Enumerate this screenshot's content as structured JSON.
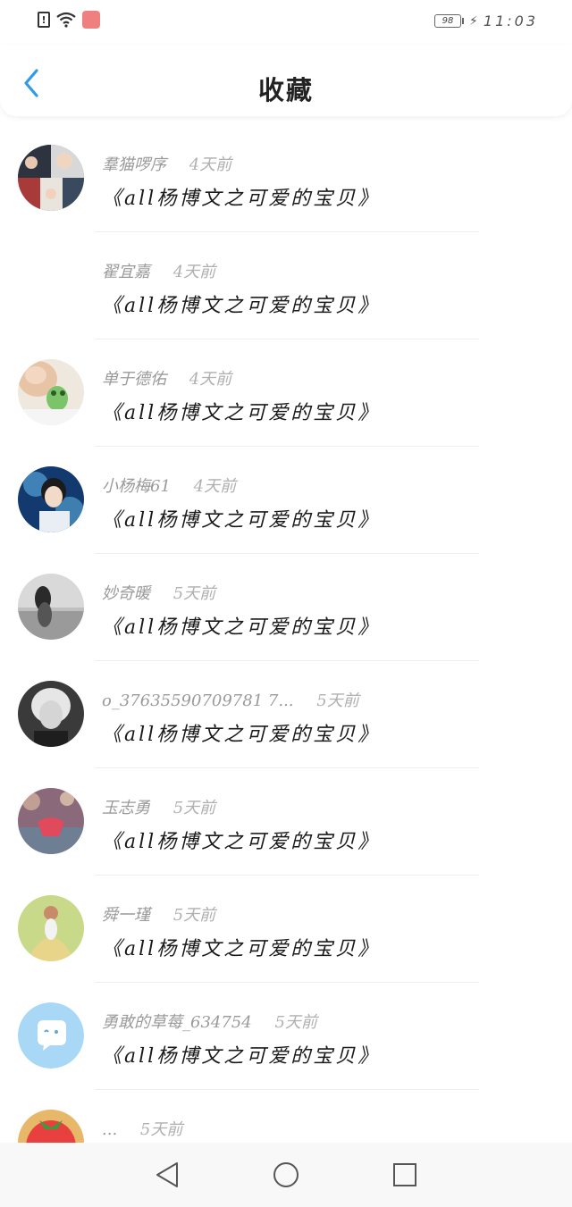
{
  "status_bar": {
    "battery_level": "98",
    "time": "11:03",
    "colors": {
      "app_badge": "#f08080"
    }
  },
  "header": {
    "title": "收藏",
    "back_icon": "chevron-left-icon",
    "accent": "#2f9bea"
  },
  "favorites": [
    {
      "user": "羣猫啰序",
      "time": "4天前",
      "title": "《all杨博文之可爱的宝贝》",
      "avatar": "photo-collage"
    },
    {
      "user": "翟宜嘉",
      "time": "4天前",
      "title": "《all杨博文之可爱的宝贝》",
      "avatar": "none"
    },
    {
      "user": "单于德佑",
      "time": "4天前",
      "title": "《all杨博文之可爱的宝贝》",
      "avatar": "photo-green-toy"
    },
    {
      "user": "小杨梅61",
      "time": "4天前",
      "title": "《all杨博文之可爱的宝贝》",
      "avatar": "photo-blue-portrait"
    },
    {
      "user": "妙奇暖",
      "time": "5天前",
      "title": "《all杨博文之可爱的宝贝》",
      "avatar": "photo-grey-seaside"
    },
    {
      "user": "o_37635590709781 7...",
      "time": "5天前",
      "title": "《all杨博文之可爱的宝贝》",
      "avatar": "photo-black-white-portrait"
    },
    {
      "user": "玉志勇",
      "time": "5天前",
      "title": "《all杨博文之可爱的宝贝》",
      "avatar": "photo-pink-bokeh"
    },
    {
      "user": "舜一瑾",
      "time": "5天前",
      "title": "《all杨博文之可爱的宝贝》",
      "avatar": "photo-yellow-girl"
    },
    {
      "user": "勇敢的草莓_634754",
      "time": "5天前",
      "title": "《all杨博文之可爱的宝贝》",
      "avatar": "chat-bubble-default"
    },
    {
      "user": "...",
      "time": "5天前",
      "title": "",
      "avatar": "photo-strawberry"
    }
  ],
  "nav_bar": {
    "back": "triangle-back-icon",
    "home": "circle-home-icon",
    "recents": "square-recents-icon"
  }
}
